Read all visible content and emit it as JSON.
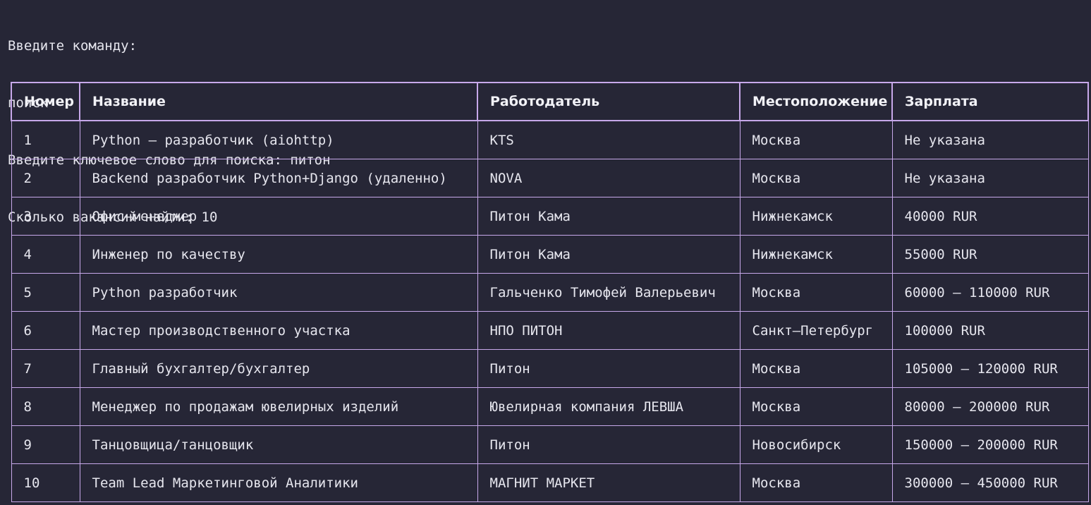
{
  "prompt": {
    "lines": [
      "Введите команду:",
      "поиск",
      "Введите ключевое слово для поиска: питон",
      "Сколько вакансий найти: 10"
    ]
  },
  "table": {
    "headers": [
      "Номер",
      "Название",
      "Работодатель",
      "Местоположение",
      "Зарплата"
    ],
    "rows": [
      [
        "1",
        "Python – разработчик (aiohttp)",
        "KTS",
        "Москва",
        "Не указана"
      ],
      [
        "2",
        "Backend разработчик Python+Django (удаленно)",
        "NOVA",
        "Москва",
        "Не указана"
      ],
      [
        "3",
        "Офис–менеджер",
        "Питон Кама",
        "Нижнекамск",
        "40000 RUR"
      ],
      [
        "4",
        "Инженер по качеству",
        "Питон Кама",
        "Нижнекамск",
        "55000 RUR"
      ],
      [
        "5",
        "Python разработчик",
        "Гальченко Тимофей Валерьевич",
        "Москва",
        "60000 – 110000 RUR"
      ],
      [
        "6",
        "Мастер производственного участка",
        "НПО ПИТОН",
        "Санкт–Петербург",
        "100000 RUR"
      ],
      [
        "7",
        "Главный бухгалтер/бухгалтер",
        "Питон",
        "Москва",
        "105000 – 120000 RUR"
      ],
      [
        "8",
        "Менеджер по продажам ювелирных изделий",
        "Ювелирная компания ЛЕВША",
        "Москва",
        "80000 – 200000 RUR"
      ],
      [
        "9",
        "Танцовщица/танцовщик",
        "Питон",
        "Новосибирск",
        "150000 – 200000 RUR"
      ],
      [
        "10",
        "Team Lead Маркетинговой Аналитики",
        "МАГНИТ МАРКЕТ",
        "Москва",
        "300000 – 450000 RUR"
      ]
    ]
  },
  "colors": {
    "background": "#262636",
    "border": "#c7a8ea",
    "text": "#e6e6ee"
  }
}
